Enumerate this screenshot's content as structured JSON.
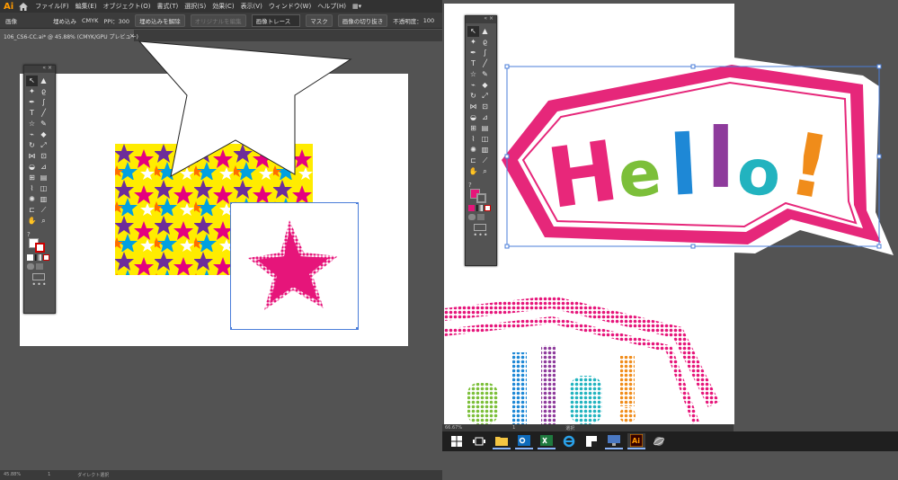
{
  "left": {
    "app_logo": "Ai",
    "menu": [
      "ファイル(F)",
      "編集(E)",
      "オブジェクト(O)",
      "書式(T)",
      "選択(S)",
      "効果(C)",
      "表示(V)",
      "ウィンドウ(W)",
      "ヘルプ(H)"
    ],
    "control": {
      "kind": "画像",
      "embed": "埋め込み",
      "colormode": "CMYK",
      "ppi": "PPI：300",
      "unembed": "埋め込みを解除",
      "edit_original": "オリジナルを編集",
      "image_trace": "画像トレース",
      "mask": "マスク",
      "crop": "画像の切り抜き",
      "opacity_label": "不透明度：",
      "opacity_value": "100"
    },
    "doc_tab": "106_CS6-CC.ai* @ 45.88% (CMYK/GPU プレビュー)",
    "doc_tab_close": "×",
    "status": {
      "zoom": "45.88%",
      "page": "1",
      "tool": "ダイレクト選択"
    }
  },
  "right": {
    "hello_letters": [
      "H",
      "e",
      "l",
      "l",
      "o",
      "!"
    ],
    "hello_colors": [
      "#e8277a",
      "#7cbf3a",
      "#1e88d6",
      "#8e3b9c",
      "#22b3bf",
      "#f08c1a"
    ],
    "status": {
      "zoom": "66.67%",
      "page": "1",
      "tool": "選択"
    }
  },
  "toolbar_close": "« ×",
  "toolbar_more": "•••",
  "colors": {
    "accent_pink": "#e6157a",
    "selection": "#4a7dd9",
    "ui_dark": "#535353"
  }
}
